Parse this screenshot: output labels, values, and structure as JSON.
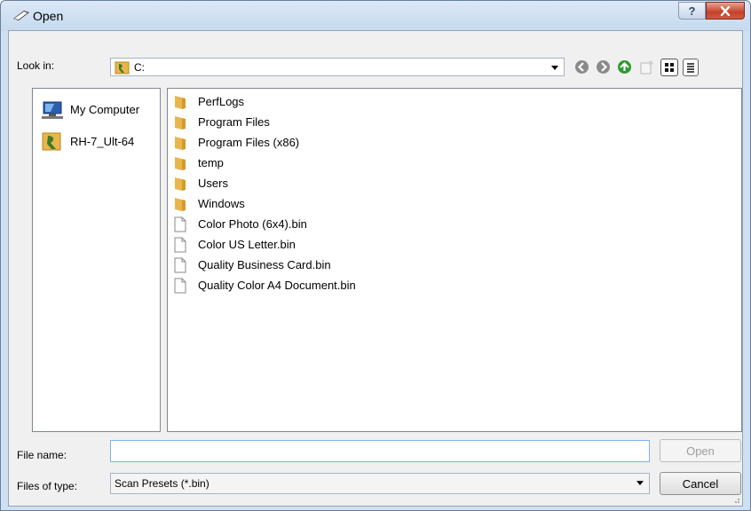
{
  "window": {
    "title": "Open",
    "help_label": "?"
  },
  "toolbar": {
    "look_in_label": "Look in:",
    "look_in_value": "C:",
    "icons": [
      "back-icon",
      "forward-icon",
      "up-folder-icon",
      "new-folder-icon",
      "view-icons-icon",
      "view-list-icon"
    ]
  },
  "places": [
    {
      "label": "My Computer",
      "icon": "computer-icon"
    },
    {
      "label": "RH-7_Ult-64",
      "icon": "user-folder-icon"
    }
  ],
  "files": [
    {
      "name": "PerfLogs",
      "type": "folder"
    },
    {
      "name": "Program Files",
      "type": "folder"
    },
    {
      "name": "Program Files (x86)",
      "type": "folder"
    },
    {
      "name": "temp",
      "type": "folder"
    },
    {
      "name": "Users",
      "type": "folder"
    },
    {
      "name": "Windows",
      "type": "folder"
    },
    {
      "name": "Color Photo (6x4).bin",
      "type": "file"
    },
    {
      "name": "Color US Letter.bin",
      "type": "file"
    },
    {
      "name": "Quality Business Card.bin",
      "type": "file"
    },
    {
      "name": "Quality Color A4 Document.bin",
      "type": "file"
    }
  ],
  "footer": {
    "file_name_label": "File name:",
    "file_name_value": "",
    "files_of_type_label": "Files of type:",
    "files_of_type_value": "Scan Presets (*.bin)",
    "open_label": "Open",
    "cancel_label": "Cancel"
  },
  "colors": {
    "folder": "#e8b64c",
    "accent": "#7eb4ea",
    "close": "#c4412a"
  }
}
